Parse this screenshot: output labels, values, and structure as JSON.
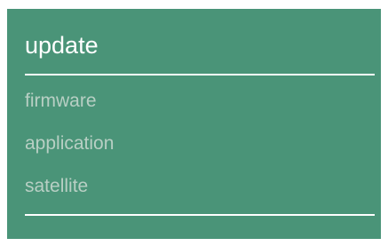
{
  "panel": {
    "title": "update",
    "items": [
      {
        "label": "firmware"
      },
      {
        "label": "application"
      },
      {
        "label": "satellite"
      }
    ]
  },
  "colors": {
    "panel_background": "#4a9478",
    "title_text": "#ffffff",
    "item_text": "#b8cfc4",
    "divider": "#ffffff"
  }
}
